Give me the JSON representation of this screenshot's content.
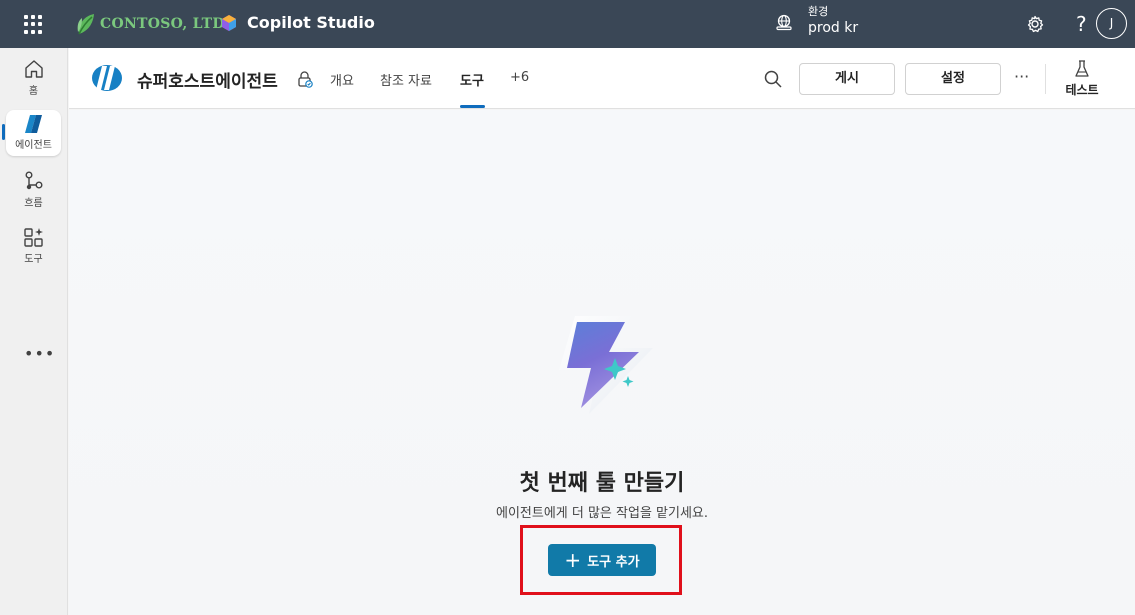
{
  "topbar": {
    "org_name": "CONTOSO, LTD.",
    "product_name": "Copilot Studio",
    "env_label": "환경",
    "env_value": "prod kr",
    "help_glyph": "?",
    "avatar_initial": "J",
    "icons": [
      "app-launcher-icon",
      "contoso-logo-icon",
      "copilot-studio-logo-icon",
      "environment-icon",
      "settings-gear-icon"
    ]
  },
  "rail": {
    "items": [
      {
        "label": "홈",
        "icon": "home-icon"
      },
      {
        "label": "에이전트",
        "icon": "agent-icon",
        "active": true
      },
      {
        "label": "흐름",
        "icon": "flow-icon"
      },
      {
        "label": "도구",
        "icon": "tools-icon"
      }
    ],
    "more": "•••"
  },
  "header": {
    "agent_name": "슈퍼호스트에이전트",
    "tabs": [
      {
        "label": "개요"
      },
      {
        "label": "참조 자료"
      },
      {
        "label": "도구",
        "active": true
      },
      {
        "label": "+6"
      }
    ],
    "publish_label": "게시",
    "settings_label": "설정",
    "more": "···",
    "test_label": "테스트"
  },
  "empty_state": {
    "title": "첫 번째 툴 만들기",
    "subtitle": "에이전트에게 더 많은 작업을 맡기세요.",
    "add_button_label": "도구 추가",
    "icon": "lightning-sparkle-icon"
  },
  "colors": {
    "topbar": "#3a4756",
    "accent": "#117aa8",
    "highlight": "#e0101b",
    "brand_green": "#7bc87e"
  }
}
